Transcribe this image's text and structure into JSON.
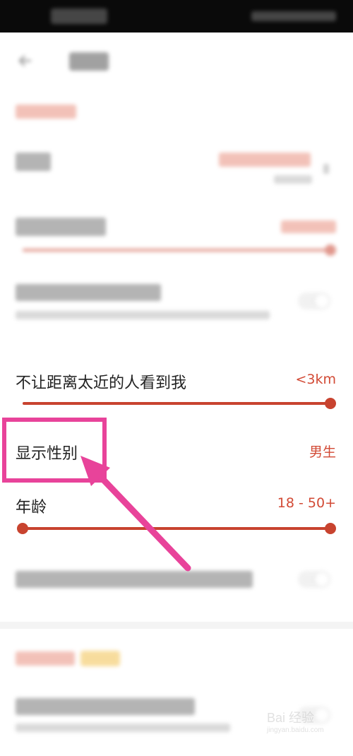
{
  "settings": {
    "proximity": {
      "label": "不让距离太近的人看到我",
      "value": "<3km",
      "slider_level": 1.0
    },
    "gender": {
      "label": "显示性别",
      "value": "男生"
    },
    "age": {
      "label": "年龄",
      "value": "18 - 50+",
      "range": [
        0.0,
        1.0
      ]
    }
  },
  "colors": {
    "accent": "#c8432f",
    "annotation": "#e8439a"
  },
  "watermark": {
    "logo": "Bai 经验",
    "url": "jingyan.baidu.com"
  }
}
